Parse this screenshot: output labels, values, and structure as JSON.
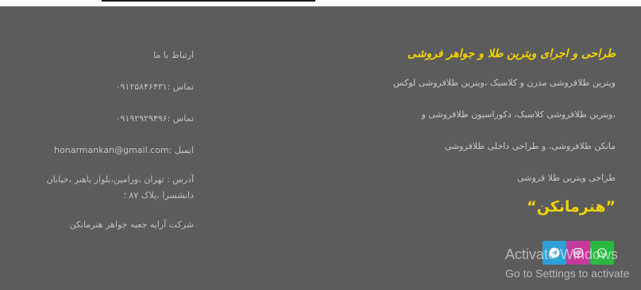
{
  "colors": {
    "background": "#5c5c5c",
    "heading": "#f2d400",
    "text": "#c8c8c8",
    "telegram": "#2f9fd8",
    "instagram": "#c43a9a",
    "whatsapp": "#2cb742"
  },
  "services": {
    "heading": "طراحی و اجرای ویترین طلا و جواهر فروشی",
    "items": [
      "ویترین طلافروشی مدرن و کلاسیک ،ویترین طلافروشی لوکس",
      "،ویترین طلافروشی کلاسیک، دکوراسیون طلافروشی و",
      "مانکن طلافروشی، و طراحی داخلی طلافروشی",
      "طراحی ویترین طلا فروشی"
    ],
    "brand": "”هنرمانکن“"
  },
  "contact": {
    "heading": "ارتباط با ما",
    "phone1": "تماس :۰۹۱۲۵۸۴۶۴۳۱",
    "phone2": "تماس :۰۹۱۹۲۹۲۹۴۹۶",
    "email": "ایمیل :honarmankan@gmail.com",
    "address": "آدرس : تهران ،ورامین،بلوار باهنر ،خیابان دانشسرا ،پلاک ۸۷ ؛",
    "company": "شرکت آرایه جعبه جواهر هنرمانکن"
  },
  "social": {
    "telegram_icon": "telegram-icon",
    "instagram_icon": "instagram-icon",
    "whatsapp_icon": "whatsapp-icon"
  },
  "watermark": {
    "line1": "Activate Windows",
    "line2": "Go to Settings to activate"
  }
}
